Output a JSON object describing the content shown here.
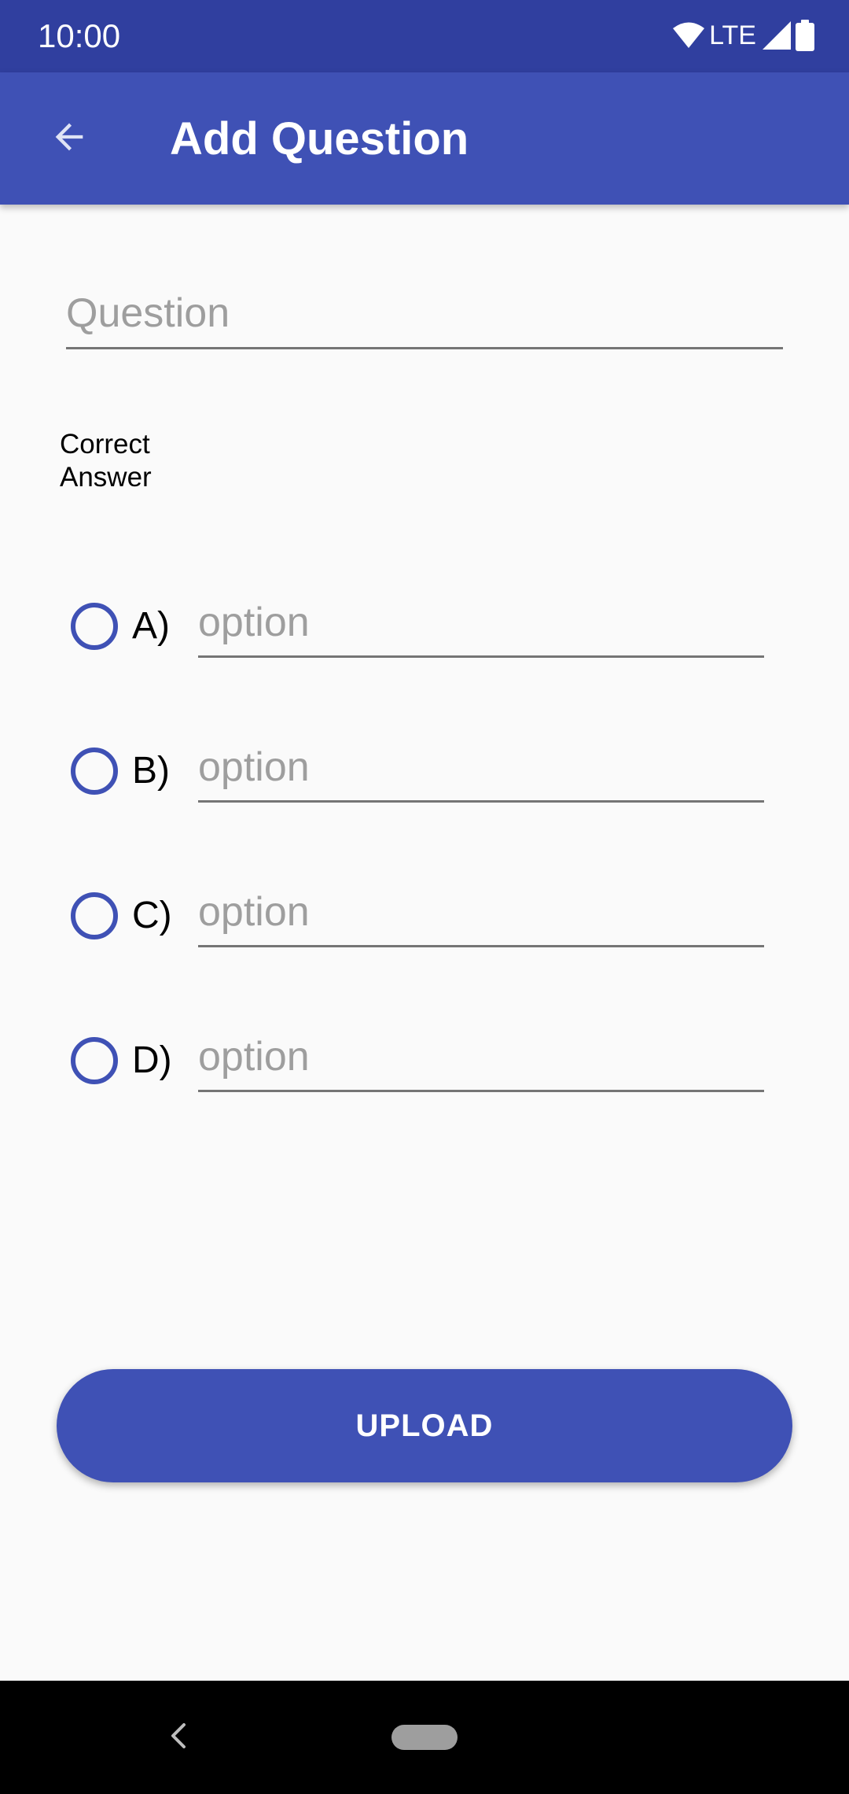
{
  "status_bar": {
    "time": "10:00",
    "network": "LTE",
    "icons": [
      "wifi-icon",
      "signal-icon",
      "battery-icon"
    ]
  },
  "app_bar": {
    "back_icon": "arrow-back-icon",
    "title": "Add Question"
  },
  "form": {
    "question_placeholder": "Question",
    "correct_answer_label": "Correct\nAnswer",
    "options": [
      {
        "letter": "A)",
        "placeholder": "option",
        "selected": false
      },
      {
        "letter": "B)",
        "placeholder": "option",
        "selected": false
      },
      {
        "letter": "C)",
        "placeholder": "option",
        "selected": false
      },
      {
        "letter": "D)",
        "placeholder": "option",
        "selected": false
      }
    ],
    "upload_label": "UPLOAD"
  },
  "nav_bar": {
    "back_icon": "nav-back-icon",
    "home_icon": "home-pill-icon"
  },
  "colors": {
    "status_bar": "#303f9f",
    "primary": "#3f51b5",
    "background": "#fafafa"
  }
}
